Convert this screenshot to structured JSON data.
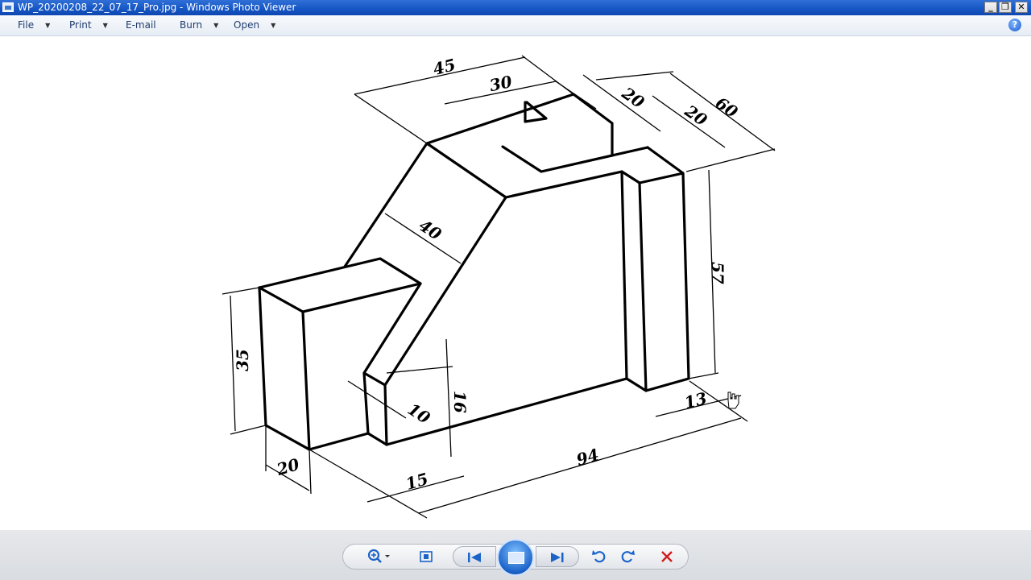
{
  "window": {
    "title": "WP_20200208_22_07_17_Pro.jpg - Windows Photo Viewer",
    "minimize": "_",
    "restore": "❐",
    "close": "✕"
  },
  "menu": {
    "file": "File",
    "print": "Print",
    "email": "E-mail",
    "burn": "Burn",
    "open": "Open",
    "help": "?"
  },
  "drawing": {
    "dimensions": {
      "d45": "45",
      "d30": "30",
      "d20a": "20",
      "d20b": "20",
      "d60": "60",
      "d40": "40",
      "d57": "57",
      "d35": "35",
      "d16": "16",
      "d10": "10",
      "d13": "13",
      "d94": "94",
      "d20c": "20",
      "d15": "15"
    }
  },
  "toolbar": {
    "zoom_icon": "magnifier-icon",
    "fit_icon": "actual-size-icon",
    "prev_icon": "previous-icon",
    "slideshow_icon": "slideshow-icon",
    "next_icon": "next-icon",
    "rotate_ccw_icon": "rotate-counterclockwise-icon",
    "rotate_cw_icon": "rotate-clockwise-icon",
    "delete_icon": "delete-icon",
    "accent": "#1b63c9",
    "delete_color": "#d01c1c"
  }
}
